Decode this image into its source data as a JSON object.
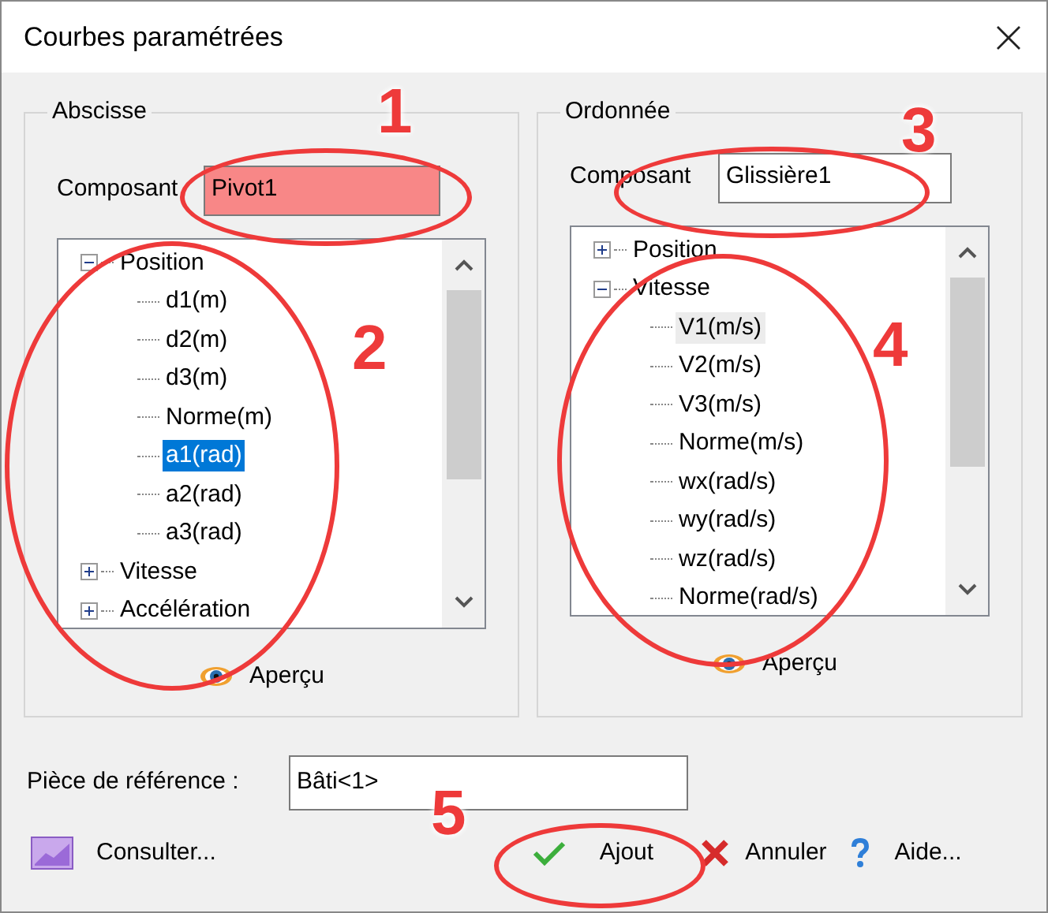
{
  "window": {
    "title": "Courbes paramétrées"
  },
  "abscisse": {
    "title": "Abscisse",
    "component_label": "Composant",
    "component_value": "Pivot1",
    "highlighted": true,
    "preview": "Aperçu",
    "tree": [
      {
        "label": "Position",
        "expanded": true,
        "selected": false,
        "hovered": false,
        "children": [
          {
            "label": "d1(m)",
            "selected": false,
            "hovered": false
          },
          {
            "label": "d2(m)",
            "selected": false,
            "hovered": false
          },
          {
            "label": "d3(m)",
            "selected": false,
            "hovered": false
          },
          {
            "label": "Norme(m)",
            "selected": false,
            "hovered": false
          },
          {
            "label": "a1(rad)",
            "selected": true,
            "hovered": false
          },
          {
            "label": "a2(rad)",
            "selected": false,
            "hovered": false
          },
          {
            "label": "a3(rad)",
            "selected": false,
            "hovered": false
          }
        ]
      },
      {
        "label": "Vitesse",
        "expanded": false,
        "selected": false,
        "hovered": false
      },
      {
        "label": "Accélération",
        "expanded": false,
        "selected": false,
        "hovered": false
      }
    ]
  },
  "ordonnee": {
    "title": "Ordonnée",
    "component_label": "Composant",
    "component_value": "Glissière1",
    "highlighted": false,
    "preview": "Aperçu",
    "tree": [
      {
        "label": "Position",
        "expanded": false,
        "selected": false,
        "hovered": false
      },
      {
        "label": "Vitesse",
        "expanded": true,
        "selected": false,
        "hovered": false,
        "children": [
          {
            "label": "V1(m/s)",
            "selected": false,
            "hovered": true
          },
          {
            "label": "V2(m/s)",
            "selected": false,
            "hovered": false
          },
          {
            "label": "V3(m/s)",
            "selected": false,
            "hovered": false
          },
          {
            "label": "Norme(m/s)",
            "selected": false,
            "hovered": false
          },
          {
            "label": "wx(rad/s)",
            "selected": false,
            "hovered": false
          },
          {
            "label": "wy(rad/s)",
            "selected": false,
            "hovered": false
          },
          {
            "label": "wz(rad/s)",
            "selected": false,
            "hovered": false
          },
          {
            "label": "Norme(rad/s)",
            "selected": false,
            "hovered": false
          }
        ]
      }
    ]
  },
  "reference": {
    "label": "Pièce de référence :",
    "value": "Bâti<1>"
  },
  "buttons": [
    {
      "kind": "chart",
      "label": "Consulter..."
    },
    {
      "kind": "check",
      "label": "Ajout"
    },
    {
      "kind": "cancel",
      "label": "Annuler"
    },
    {
      "kind": "help",
      "label": "Aide..."
    }
  ],
  "annotations": [
    {
      "label": "1"
    },
    {
      "label": "2"
    },
    {
      "label": "3"
    },
    {
      "label": "4"
    },
    {
      "label": "5"
    }
  ]
}
